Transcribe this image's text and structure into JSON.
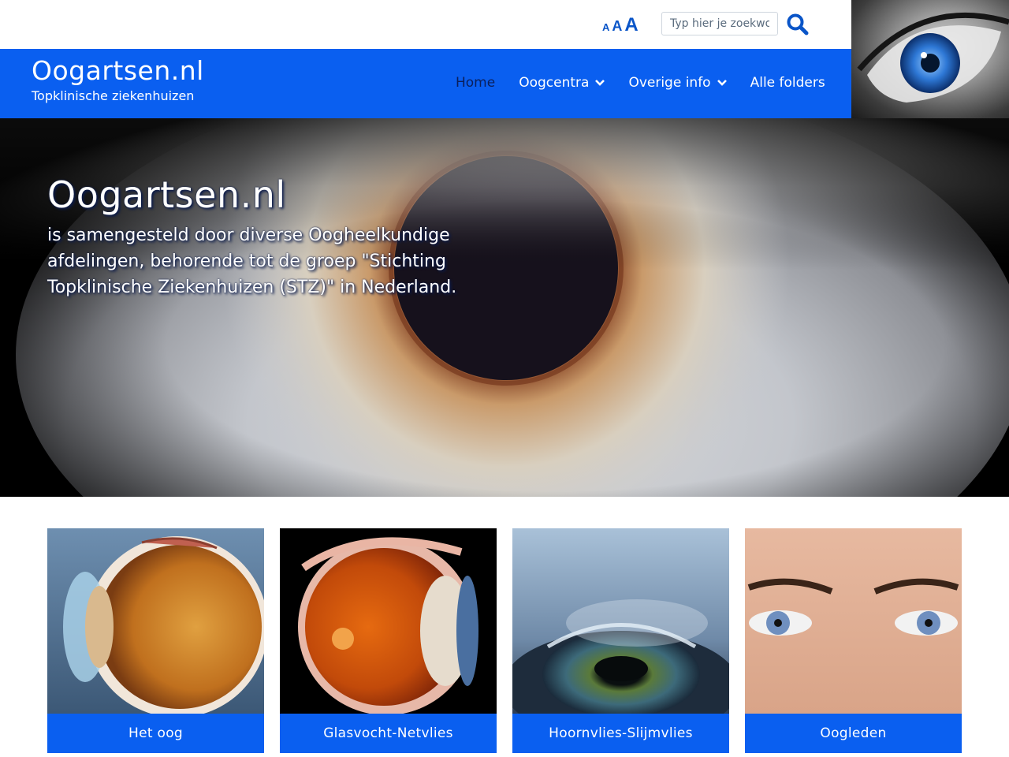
{
  "toolbar": {
    "font_small": "A",
    "font_medium": "A",
    "font_large": "A",
    "search_placeholder": "Typ hier je zoekwoord",
    "search_icon": "search-icon"
  },
  "header": {
    "site_title": "Oogartsen.nl",
    "site_subtitle": "Topklinische ziekenhuizen",
    "nav": [
      {
        "label": "Home",
        "active": true
      },
      {
        "label": "Oogcentra",
        "dropdown": true
      },
      {
        "label": "Overige info",
        "dropdown": true
      },
      {
        "label": "Alle folders"
      }
    ]
  },
  "hero": {
    "title": "Oogartsen.nl",
    "text": "is samengesteld door diverse Oogheelkundige afdelingen, behorende tot de groep \"Stichting Topklinische Ziekenhuizen (STZ)\" in Nederland."
  },
  "cards": [
    {
      "label": "Het oog"
    },
    {
      "label": "Glasvocht-Netvlies"
    },
    {
      "label": "Hoornvlies-Slijmvlies"
    },
    {
      "label": "Oogleden"
    }
  ],
  "colors": {
    "brand_blue": "#0a5ff0",
    "active_nav": "#0b1f5a",
    "icon_blue": "#0a55c8"
  }
}
